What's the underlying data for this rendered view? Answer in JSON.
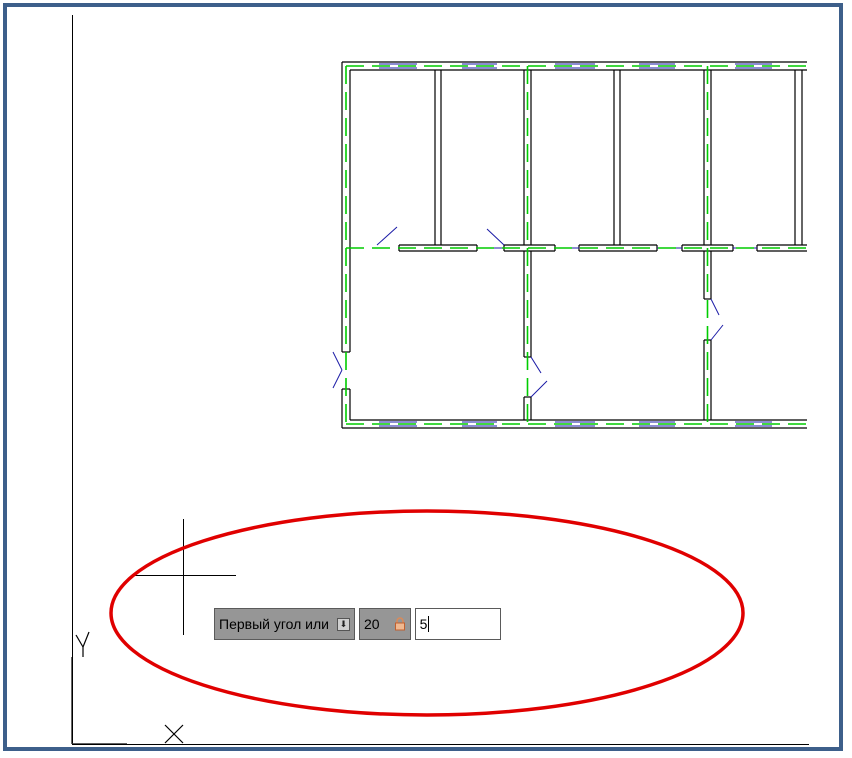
{
  "ucs_icon": {
    "y_label": "Y",
    "x_label": "X"
  },
  "dynamic_input": {
    "prompt_label": "Первый угол или",
    "prompt_menu_icon": "down-arrow-icon",
    "first_value": "20",
    "lock_icon": "lock-icon",
    "second_value": "5"
  },
  "colors": {
    "frame": "#3d5f8a",
    "wall": "#000000",
    "axis_line": "#00cc00",
    "window_line": "#1a1aa6",
    "highlight_ellipse": "#e00000",
    "prompt_bg": "#969696"
  }
}
